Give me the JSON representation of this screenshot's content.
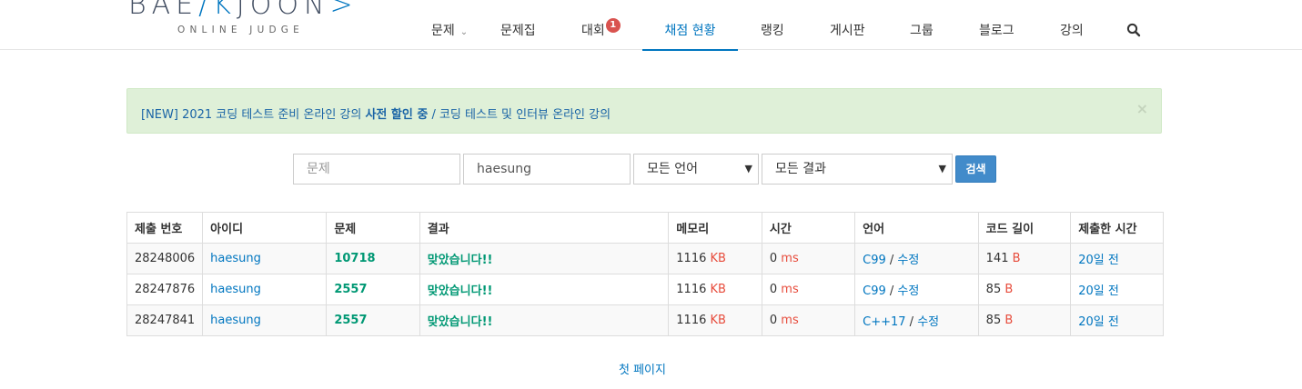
{
  "logo": {
    "main_left": "BAE",
    "main_mid": "K",
    "main_right": "JOON",
    "subtitle": "ONLINE JUDGE"
  },
  "nav": {
    "items": [
      {
        "label": "문제",
        "has_caret": true
      },
      {
        "label": "문제집"
      },
      {
        "label": "대회",
        "badge": "1"
      },
      {
        "label": "채점 현황",
        "active": true
      },
      {
        "label": "랭킹"
      },
      {
        "label": "게시판"
      },
      {
        "label": "그룹"
      },
      {
        "label": "블로그"
      },
      {
        "label": "강의"
      }
    ],
    "search_icon": "search-icon"
  },
  "alert": {
    "prefix": "[NEW] 2021 코딩 테스트 준비 온라인 강의 ",
    "highlight": "사전 할인 중",
    "suffix": " / 코딩 테스트 및 인터뷰 온라인 강의",
    "close": "×"
  },
  "filters": {
    "problem_placeholder": "문제",
    "user_value": "haesung",
    "language": "모든 언어",
    "result": "모든 결과",
    "search_button": "검색"
  },
  "table": {
    "headers": [
      "제출 번호",
      "아이디",
      "문제",
      "결과",
      "메모리",
      "시간",
      "언어",
      "코드 길이",
      "제출한 시간"
    ],
    "rows": [
      {
        "id": "28248006",
        "user": "haesung",
        "problem": "10718",
        "result": "맞았습니다!!",
        "memory": "1116",
        "memory_unit": "KB",
        "time": "0",
        "time_unit": "ms",
        "lang": "C99",
        "edit": "수정",
        "length": "141",
        "length_unit": "B",
        "submitted": "20일 전"
      },
      {
        "id": "28247876",
        "user": "haesung",
        "problem": "2557",
        "result": "맞았습니다!!",
        "memory": "1116",
        "memory_unit": "KB",
        "time": "0",
        "time_unit": "ms",
        "lang": "C99",
        "edit": "수정",
        "length": "85",
        "length_unit": "B",
        "submitted": "20일 전"
      },
      {
        "id": "28247841",
        "user": "haesung",
        "problem": "2557",
        "result": "맞았습니다!!",
        "memory": "1116",
        "memory_unit": "KB",
        "time": "0",
        "time_unit": "ms",
        "lang": "C++17",
        "edit": "수정",
        "length": "85",
        "length_unit": "B",
        "submitted": "20일 전"
      }
    ]
  },
  "pagination": {
    "first_page": "첫 페이지"
  },
  "colors": {
    "accent": "#0076c0",
    "success": "#009874",
    "unit": "#e74c3c",
    "alert_bg": "#dff0d8",
    "button": "#428bca"
  }
}
